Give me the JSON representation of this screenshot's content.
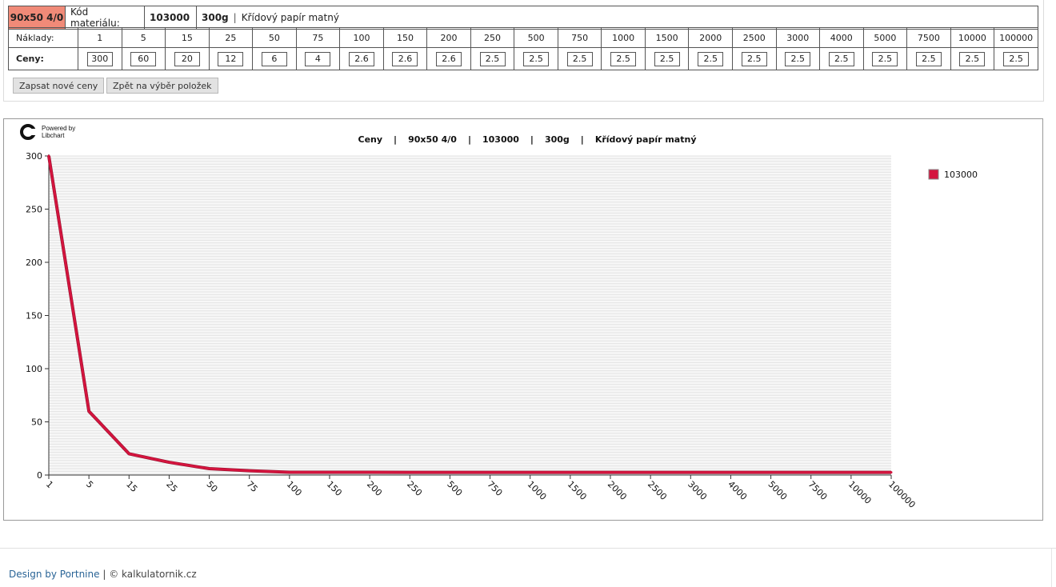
{
  "header": {
    "product_code": "90x50 4/0",
    "material_label": "Kód materiálu:",
    "material_code": "103000",
    "weight": "300g",
    "separator": "|",
    "paper": "Křídový papír matný"
  },
  "price_table": {
    "qty_label": "Náklady:",
    "price_label": "Ceny:",
    "quantities": [
      "1",
      "5",
      "15",
      "25",
      "50",
      "75",
      "100",
      "150",
      "200",
      "250",
      "500",
      "750",
      "1000",
      "1500",
      "2000",
      "2500",
      "3000",
      "4000",
      "5000",
      "7500",
      "10000",
      "100000"
    ],
    "prices": [
      "300",
      "60",
      "20",
      "12",
      "6",
      "4",
      "2.6",
      "2.6",
      "2.6",
      "2.5",
      "2.5",
      "2.5",
      "2.5",
      "2.5",
      "2.5",
      "2.5",
      "2.5",
      "2.5",
      "2.5",
      "2.5",
      "2.5",
      "2.5"
    ]
  },
  "buttons": {
    "save": "Zapsat nové ceny",
    "back": "Zpět na výběr položek"
  },
  "chart": {
    "logo_line1": "Powered by",
    "logo_line2": "Libchart",
    "title_parts": [
      "Ceny",
      "90x50 4/0",
      "103000",
      "300g",
      "Křídový papír matný"
    ],
    "title_separator": "|"
  },
  "chart_data": {
    "type": "line",
    "title": "Ceny | 90x50 4/0 | 103000 | 300g | Křídový papír matný",
    "categories": [
      "1",
      "5",
      "15",
      "25",
      "50",
      "75",
      "100",
      "150",
      "200",
      "250",
      "500",
      "750",
      "1000",
      "1500",
      "2000",
      "2500",
      "3000",
      "4000",
      "5000",
      "7500",
      "10000",
      "100000"
    ],
    "series": [
      {
        "name": "103000",
        "values": [
          300,
          60,
          20,
          12,
          6,
          4,
          2.6,
          2.6,
          2.6,
          2.5,
          2.5,
          2.5,
          2.5,
          2.5,
          2.5,
          2.5,
          2.5,
          2.5,
          2.5,
          2.5,
          2.5,
          2.5
        ]
      }
    ],
    "y_ticks": [
      0,
      50,
      100,
      150,
      200,
      250,
      300
    ],
    "ylim": [
      0,
      300
    ],
    "legend_position": "right",
    "grid": true,
    "series_color": "#d4143e"
  },
  "footer": {
    "design_link": "Design by Portnine",
    "separator": "|",
    "copyright": "© kalkulatornik.cz"
  }
}
